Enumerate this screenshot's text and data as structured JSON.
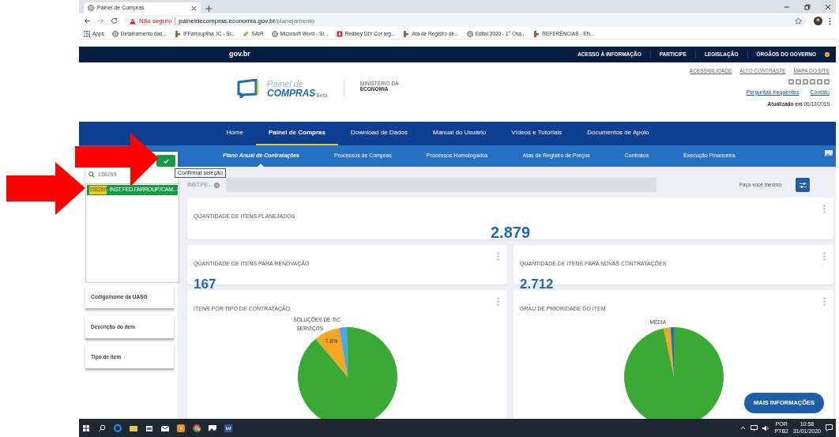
{
  "browser": {
    "tab_title": "Painel de Compras",
    "security": "Não seguro",
    "url_host": "paineldecompras.economia.gov.br",
    "url_path": "/planejamento",
    "bookmarks": [
      {
        "label": "Apps",
        "kind": "apps"
      },
      {
        "label": "Detalhamento das...",
        "kind": "globe"
      },
      {
        "label": "IFFarroupilha JC - Si...",
        "kind": "flag"
      },
      {
        "label": "SAIR",
        "kind": "leaf"
      },
      {
        "label": "Microsoft Word - SI...",
        "kind": "globe"
      },
      {
        "label": "Redbey DIY Cor arg...",
        "kind": "red"
      },
      {
        "label": "Ata de Registro de...",
        "kind": "flag"
      },
      {
        "label": "Edital 2020 - 1° Cha...",
        "kind": "globe"
      },
      {
        "label": "REFERÊNCIAS - EN...",
        "kind": "flag"
      }
    ]
  },
  "gov_bar": {
    "logo": "gov.br",
    "links": [
      "ACESSO À INFORMAÇÃO",
      "PARTICIPE",
      "LEGISLAÇÃO",
      "ÓRGÃOS DO GOVERNO"
    ]
  },
  "header": {
    "logo_line1": "Painel de",
    "logo_line2": "COMPRAS",
    "logo_badge": "Beta",
    "ministry_line1": "MINISTÉRIO DA",
    "ministry_line2": "ECONOMIA",
    "access_links": [
      "ACESSIBILIDADE",
      "ALTO CONTRASTE",
      "MAPA DO SITE"
    ],
    "links": [
      "Perguntas frequentes",
      "Contato"
    ],
    "updated": "**Atualizado em** 06/12/2019"
  },
  "main_nav": [
    {
      "label": "Home",
      "selected": false
    },
    {
      "label": "Painel de Compras",
      "selected": true
    },
    {
      "label": "Download de Dados",
      "selected": false
    },
    {
      "label": "Manual do Usuário",
      "selected": false
    },
    {
      "label": "Vídeos e Tutoriais",
      "selected": false
    },
    {
      "label": "Documentos de Apoio",
      "selected": false
    }
  ],
  "sub_nav": [
    {
      "label": "Plano Anual de Contratações",
      "selected": true
    },
    {
      "label": "Processos de Compras",
      "selected": false
    },
    {
      "label": "Processos Homologados",
      "selected": false
    },
    {
      "label": "Atas de Registro de Preços",
      "selected": false
    },
    {
      "label": "Contratos",
      "selected": false
    },
    {
      "label": "Execução Financeira",
      "selected": false
    }
  ],
  "filter_panel": {
    "search_value": "158269",
    "tooltip": "Confirmar seleção",
    "chip": "INST.FE...",
    "options": [
      {
        "code": "158269",
        "label": " - INST.FED.FARROUP./CAM...",
        "selected": true
      }
    ],
    "filters": [
      "Código/nome da UASG",
      "Descrição do item",
      "Tipo de item"
    ]
  },
  "toolbar": {
    "diy_label": "Faça você mesmo"
  },
  "cards": [
    {
      "title": "QUANTIDADE DE ITENS PLANEJADOS",
      "value": "2.879"
    },
    {
      "title": "QUANTIDADE DE ITENS PARA RENOVAÇÃO",
      "value": "167"
    },
    {
      "title": "QUANTIDADE DE ITENS PARA NOVAS CONTRATAÇÕES",
      "value": "2.712"
    }
  ],
  "charts": [
    {
      "title": "ITENS POR TIPO DE CONTRATAÇÃO",
      "labels": [
        "SOLUÇÕES DE TIC",
        "SERVIÇOS",
        "7.8%"
      ]
    },
    {
      "title": "GRAU DE PRIORIDADE DO ITEM",
      "labels": [
        "MÉDIA"
      ]
    }
  ],
  "more_button": "MAIS INFORMAÇÕES",
  "taskbar": {
    "lang": "POR",
    "layout": "PTB2",
    "time": "10:58",
    "date": "31/01/2020"
  }
}
